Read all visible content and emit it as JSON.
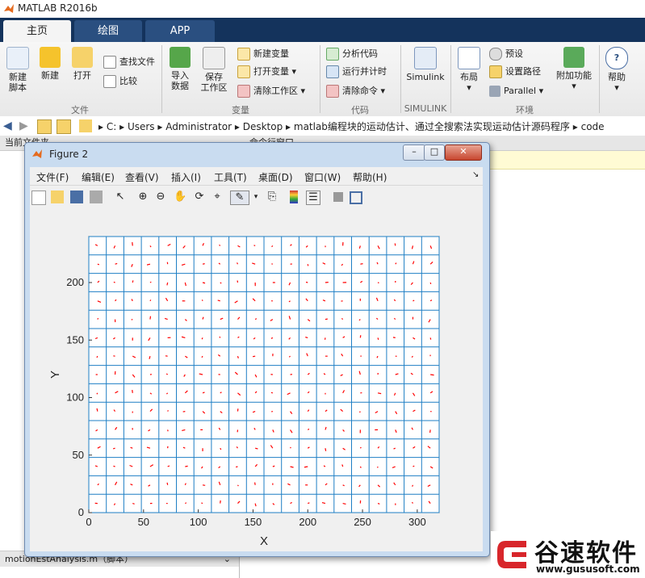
{
  "app": {
    "title": "MATLAB R2016b"
  },
  "tabs": [
    {
      "label": "主页"
    },
    {
      "label": "绘图"
    },
    {
      "label": "APP"
    }
  ],
  "ribbon": {
    "new_script": "新建\n脚本",
    "new": "新建",
    "open": "打开",
    "find_files": "查找文件",
    "compare": "比较",
    "import_data": "导入\n数据",
    "save_workspace": "保存\n工作区",
    "new_variable": "新建变量",
    "open_variable": "打开变量",
    "clear_workspace": "清除工作区",
    "analyze_code": "分析代码",
    "run_and_time": "运行并计时",
    "clear_commands": "清除命令",
    "simulink": "Simulink",
    "layout": "布局",
    "preferences": "预设",
    "set_path": "设置路径",
    "parallel": "Parallel",
    "addons": "附加功能",
    "help": "帮助",
    "groups": {
      "file": "文件",
      "variable": "变量",
      "code": "代码",
      "simulink": "SIMULINK",
      "environment": "环境"
    }
  },
  "address": {
    "crumbs": [
      "C:",
      "Users",
      "Administrator",
      "Desktop",
      "matlab编程块的运动估计、通过全搜索法实现运动估计源码程序",
      "code"
    ]
  },
  "left_panel": {
    "header": "当前文件夹",
    "bottom_file": "motionEstAnalysis.m（脚本）"
  },
  "right_panel": {
    "header": "命令行窗口"
  },
  "figure": {
    "title": "Figure 2",
    "menu": [
      "文件(F)",
      "编辑(E)",
      "查看(V)",
      "插入(I)",
      "工具(T)",
      "桌面(D)",
      "窗口(W)",
      "帮助(H)"
    ],
    "minimize": "–",
    "maximize": "□",
    "close": "✕"
  },
  "chart_data": {
    "type": "scatter",
    "title": "",
    "xlabel": "X",
    "ylabel": "Y",
    "xlim": [
      0,
      320
    ],
    "ylim": [
      0,
      240
    ],
    "xticks": [
      0,
      50,
      100,
      150,
      200,
      250,
      300
    ],
    "yticks": [
      0,
      50,
      100,
      150,
      200
    ],
    "grid_step": 16,
    "grid_color": "#1f7fc4",
    "vector_color": "#ff0000",
    "description_series": "motion vectors at 16x16 block centers"
  },
  "watermark": {
    "brand": "谷速软件",
    "url": "www.gususoft.com",
    "color": "#d8262b"
  }
}
